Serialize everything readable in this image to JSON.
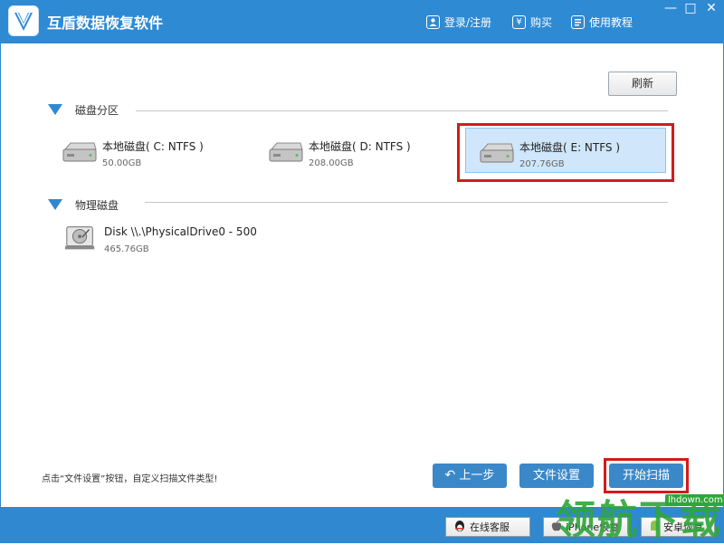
{
  "app": {
    "title": "互盾数据恢复软件"
  },
  "toolbar": {
    "login_label": "登录/注册",
    "buy_label": "购买",
    "tutorial_label": "使用教程",
    "buy_symbol": "¥"
  },
  "window_controls": {
    "minimize": "—",
    "maximize": "□",
    "close": "✕"
  },
  "refresh_label": "刷新",
  "partitions": {
    "label": "磁盘分区",
    "items": [
      {
        "name": "本地磁盘( C: NTFS )",
        "size": "50.00GB",
        "selected": false
      },
      {
        "name": "本地磁盘( D: NTFS )",
        "size": "208.00GB",
        "selected": false
      },
      {
        "name": "本地磁盘( E: NTFS )",
        "size": "207.76GB",
        "selected": true
      }
    ]
  },
  "physical": {
    "label": "物理磁盘",
    "items": [
      {
        "name": "Disk \\\\.\\PhysicalDrive0 - 500",
        "size": "465.76GB"
      }
    ]
  },
  "hint": "点击“文件设置”按钮，自定义扫描文件类型!",
  "buttons": {
    "back": "上一步",
    "file_settings": "文件设置",
    "start_scan": "开始扫描"
  },
  "statusbar": {
    "online_service": "在线客服",
    "iphone_recovery": "iPhone恢复",
    "android_recovery": "安卓恢复"
  },
  "watermark": {
    "text": "领航下载",
    "url": "lhdown.com"
  },
  "colors": {
    "titlebar": "#2f8ad4",
    "accent": "#3b88c9",
    "highlight": "#d31b1b",
    "selected_bg": "#cfe6fb"
  }
}
